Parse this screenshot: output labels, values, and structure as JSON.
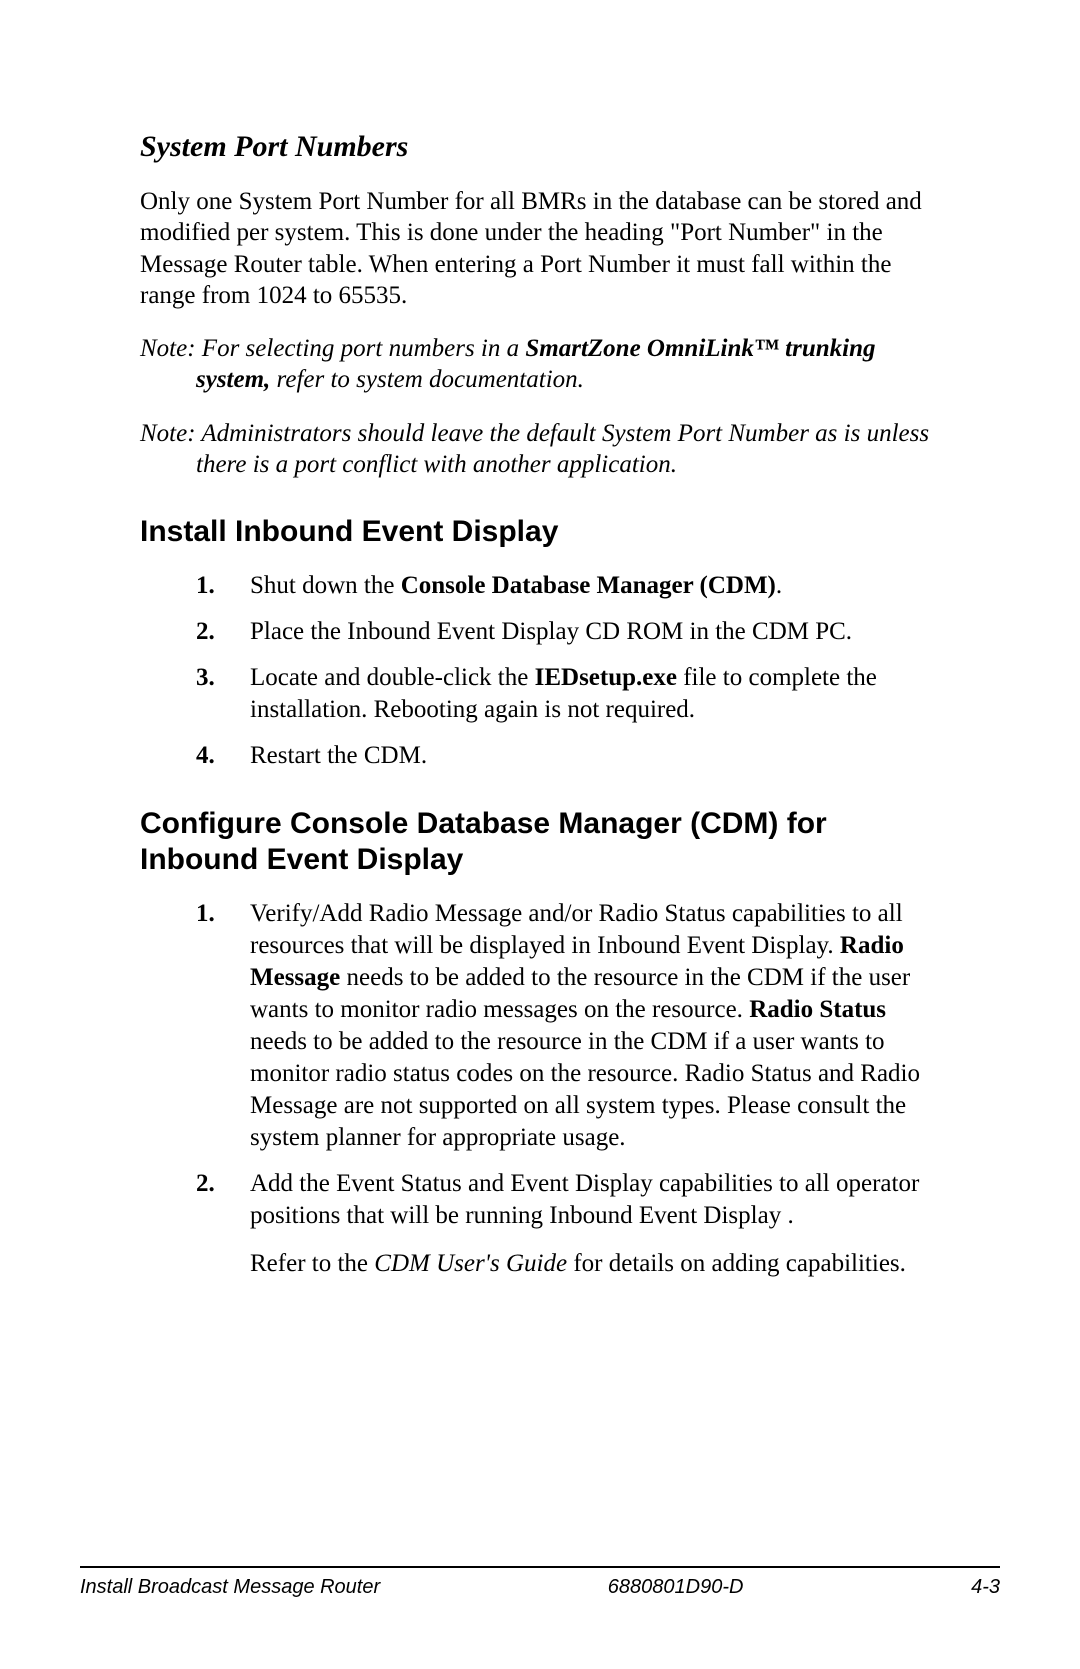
{
  "section1": {
    "heading": "System Port Numbers",
    "para": "Only one System Port Number for all BMRs in the database can be stored and modified per system.  This is done under the heading \"Port Number\" in the Message Router table.  When entering a Port Number it must fall within the range from 1024 to 65535.",
    "note1_label": "Note:",
    "note1_pre": "  For selecting port numbers in a ",
    "note1_bold": "SmartZone OmniLink™ trunking system,",
    "note1_post": " refer to system documentation.",
    "note2_label": "Note:",
    "note2_text": "  Administrators should leave the default System Port Number as is unless there is a port conflict with another application."
  },
  "section2": {
    "heading": "Install Inbound Event Display",
    "steps": [
      {
        "num": "1.",
        "pre": "Shut down the ",
        "bold": "Console Database Manager (CDM)",
        "post": "."
      },
      {
        "num": "2.",
        "pre": "Place the Inbound Event Display CD ROM in the CDM PC.",
        "bold": "",
        "post": ""
      },
      {
        "num": "3.",
        "pre": "Locate and double-click the ",
        "bold": "IEDsetup.exe",
        "post": " file to complete the installation.  Rebooting again is not required."
      },
      {
        "num": "4.",
        "pre": "Restart the CDM.",
        "bold": "",
        "post": ""
      }
    ]
  },
  "section3": {
    "heading": "Configure Console Database Manager (CDM) for Inbound Event Display",
    "step1": {
      "num": "1.",
      "t1": "Verify/Add Radio Message and/or Radio Status capabilities to all resources that will be displayed in Inbound Event Display. ",
      "b1": "Radio Message",
      "t2": " needs to be added to the resource in the CDM if the user wants to monitor radio messages on the resource.  ",
      "b2": "Radio Status",
      "t3": " needs to be added to the resource in the CDM if a user wants to monitor radio status codes on the resource.  Radio Status and Radio Message are not supported on all system types.  Please consult the system planner for appropriate usage."
    },
    "step2": {
      "num": "2.",
      "text": "Add the Event Status and Event Display capabilities to all operator positions that will be running Inbound Event Display ."
    },
    "closing_pre": "Refer to the ",
    "closing_italic": "CDM User's Guide",
    "closing_post": " for details on adding capabilities."
  },
  "footer": {
    "left": "Install Broadcast Message Router",
    "center": "6880801D90-D",
    "right": "4-3"
  }
}
